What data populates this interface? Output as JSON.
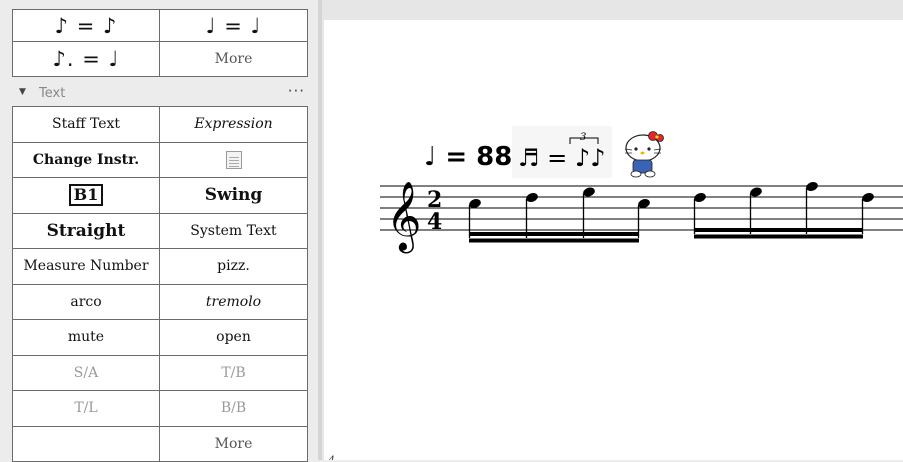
{
  "palette": {
    "tempo": {
      "rows": [
        [
          "♪ = ♪",
          "♩ = ♩"
        ],
        [
          "♪. = ♩",
          "More"
        ]
      ]
    },
    "text_section": {
      "title": "Text",
      "menu_icon": "ellipsis-icon",
      "collapse_icon": "triangle-down-icon"
    },
    "text_items": {
      "staff_text": "Staff Text",
      "expression": "Expression",
      "change_instr": "Change Instr.",
      "rehearsal_mark": "B1",
      "swing": "Swing",
      "straight": "Straight",
      "system_text": "System Text",
      "measure_number": "Measure Number",
      "pizz": "pizz.",
      "arco": "arco",
      "tremolo": "tremolo",
      "mute": "mute",
      "open": "open",
      "sa": "S/A",
      "tb": "T/B",
      "tl": "T/L",
      "bb": "B/B",
      "more": "More"
    }
  },
  "score": {
    "tempo_text": "♩ = 88,",
    "metric_modulation": "♬ = ♪♪",
    "tuplet_number": "3",
    "time_signature": {
      "numerator": "2",
      "denominator": "4"
    },
    "clef": "treble-clef-icon",
    "sticker": "hello-kitty-sticker",
    "page_number": "4"
  }
}
